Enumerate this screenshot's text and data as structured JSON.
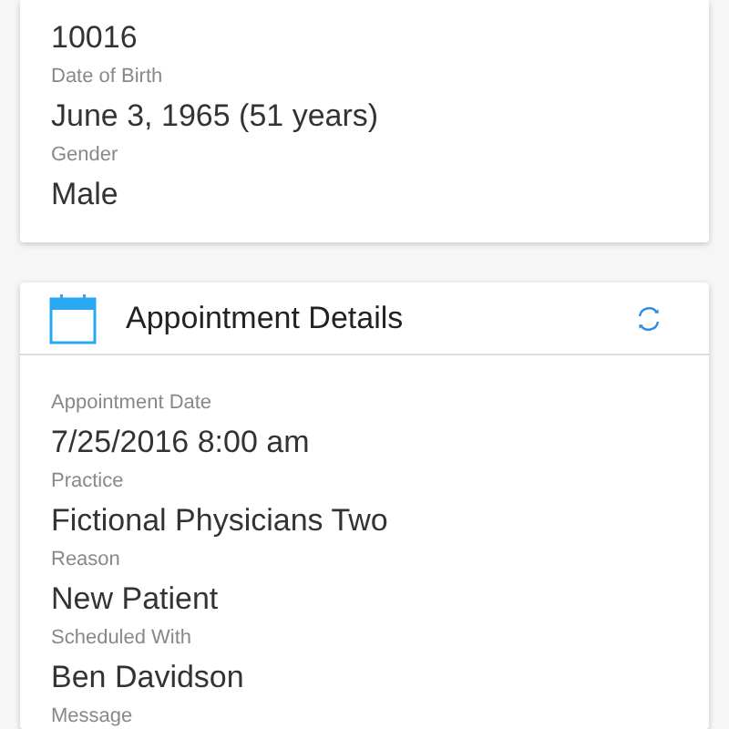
{
  "patient_card": {
    "fields": [
      {
        "value": "10016"
      },
      {
        "label": "Date of Birth",
        "value": "June 3, 1965 (51 years)"
      },
      {
        "label": "Gender",
        "value": "Male"
      }
    ]
  },
  "appointment_card": {
    "title": "Appointment Details",
    "fields": [
      {
        "label": "Appointment Date",
        "value": "7/25/2016 8:00 am"
      },
      {
        "label": "Practice",
        "value": "Fictional Physicians Two"
      },
      {
        "label": "Reason",
        "value": "New Patient"
      },
      {
        "label": "Scheduled With",
        "value": "Ben Davidson"
      },
      {
        "label": "Message"
      }
    ]
  }
}
